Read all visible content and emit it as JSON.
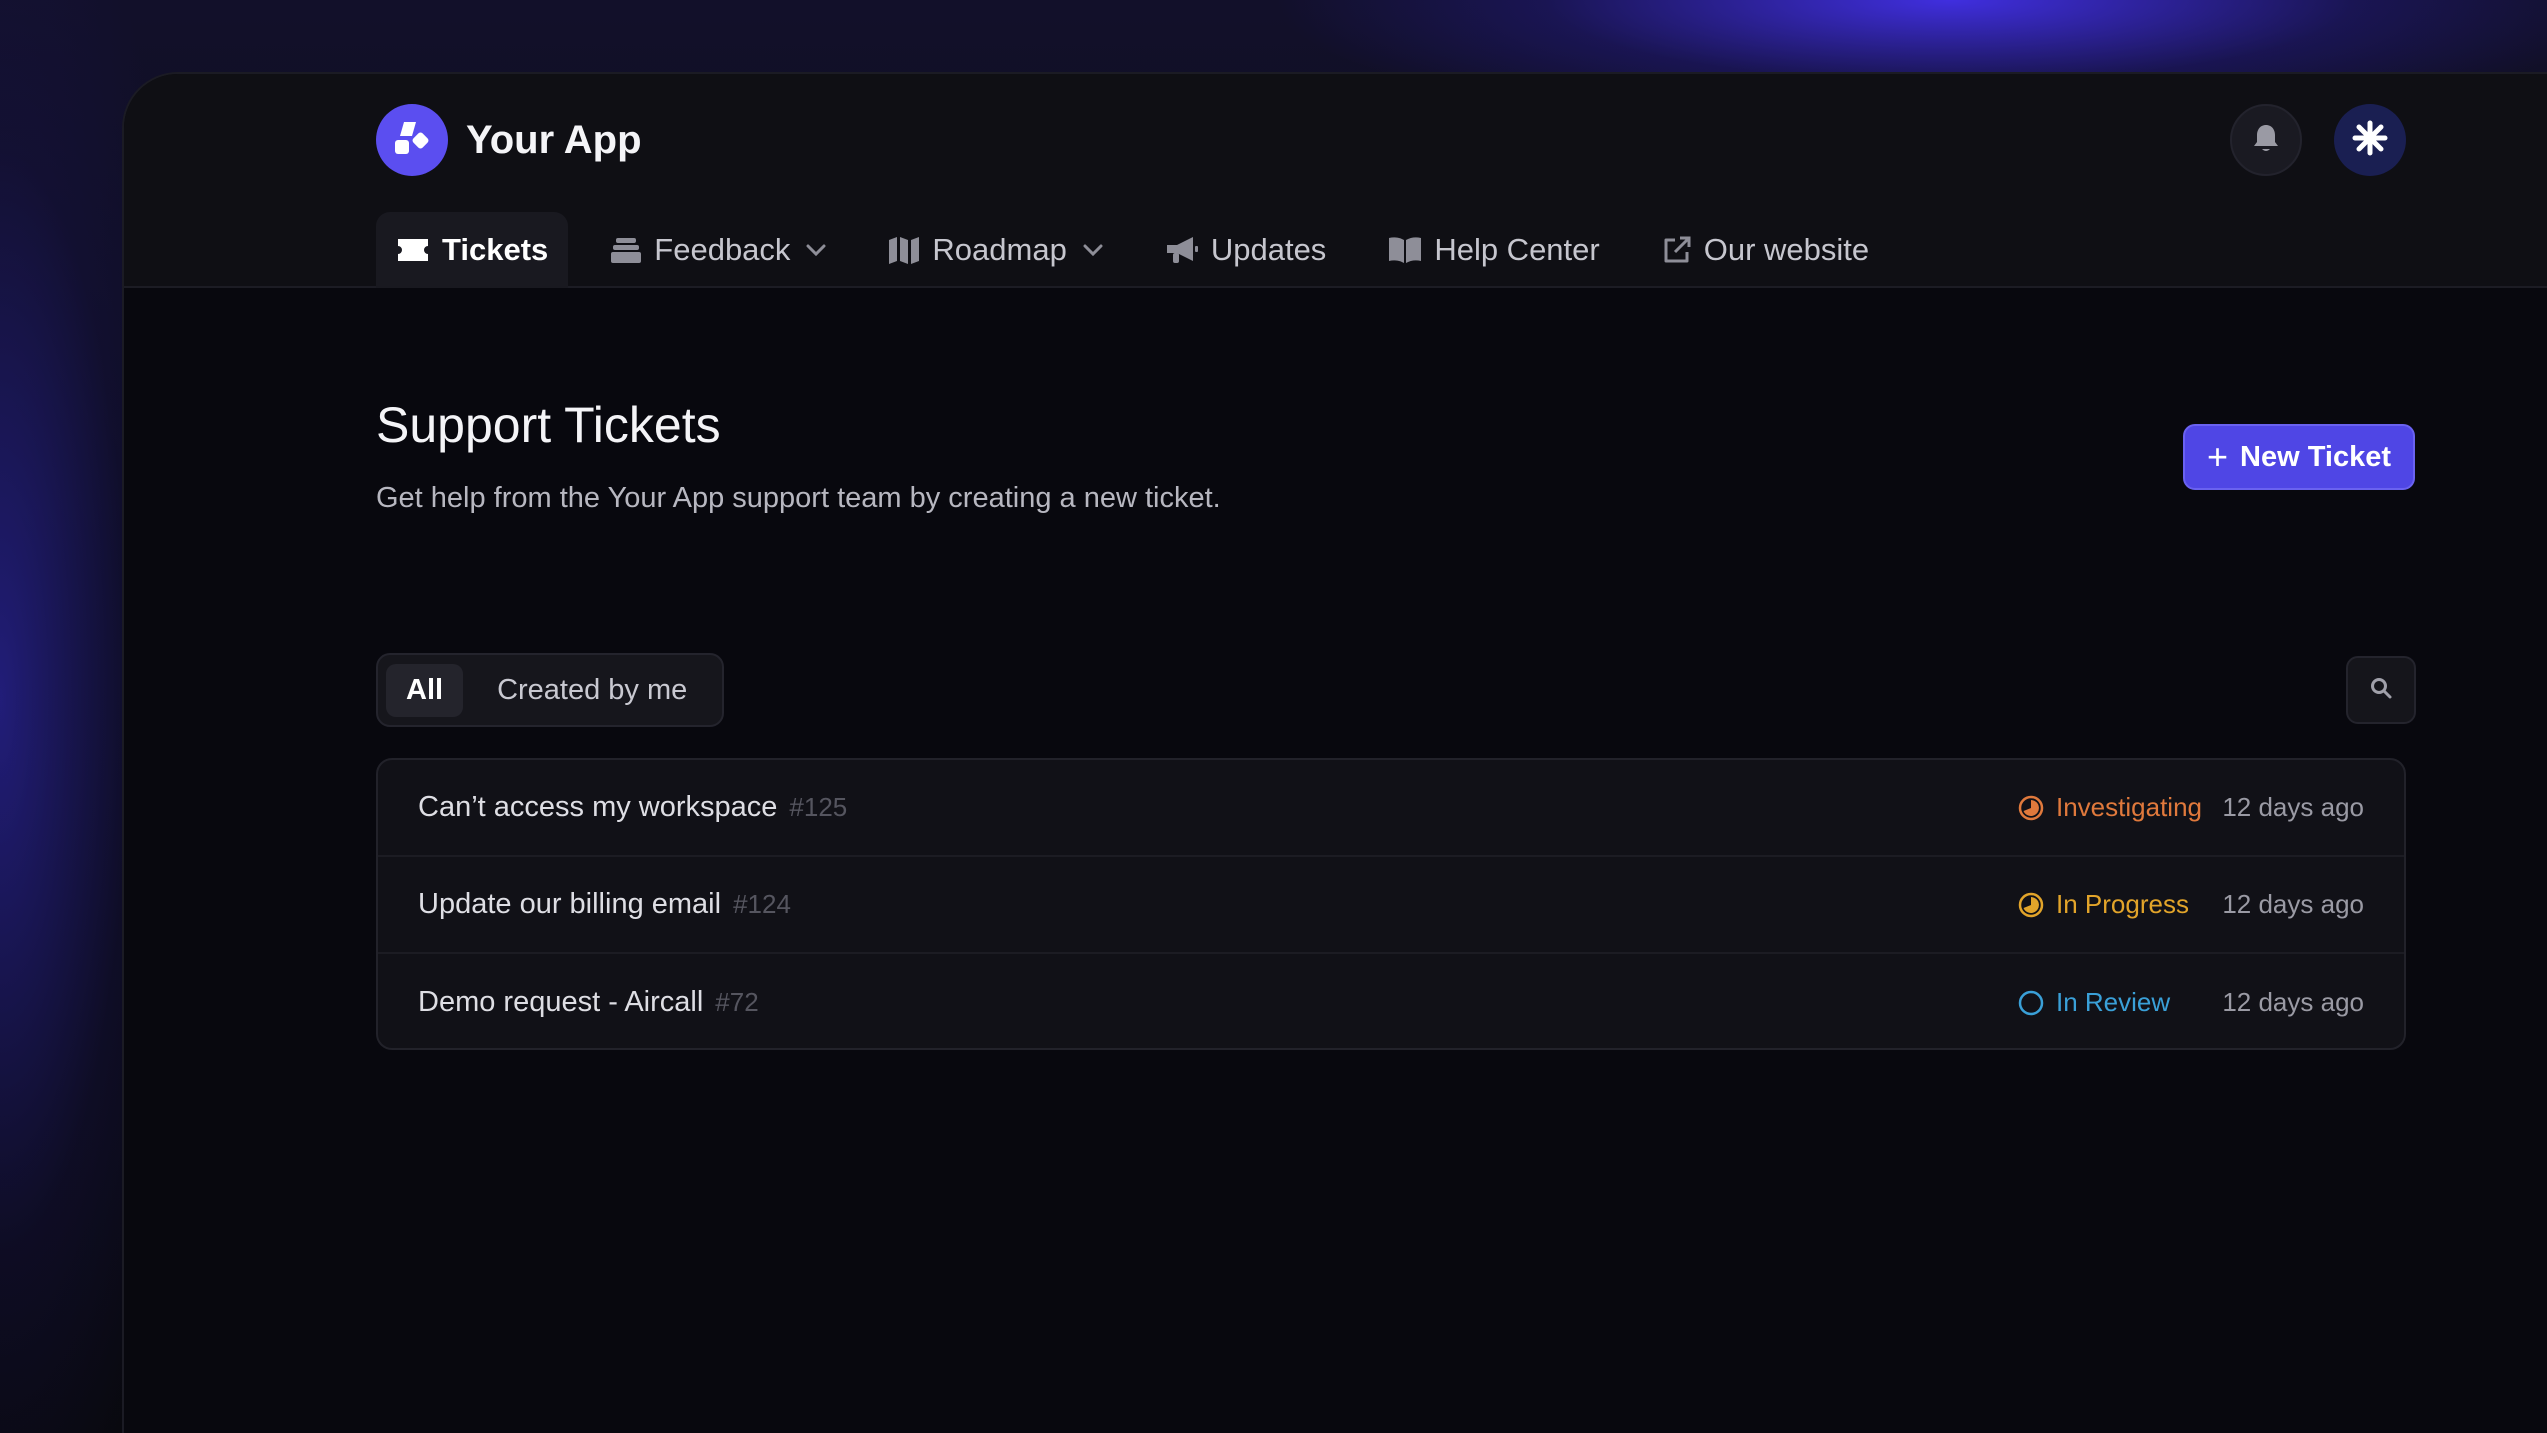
{
  "app": {
    "name": "Your App"
  },
  "nav": {
    "tabs": [
      {
        "label": "Tickets",
        "icon": "ticket-icon",
        "active": true,
        "dropdown": false
      },
      {
        "label": "Feedback",
        "icon": "inbox-icon",
        "active": false,
        "dropdown": true
      },
      {
        "label": "Roadmap",
        "icon": "map-icon",
        "active": false,
        "dropdown": true
      },
      {
        "label": "Updates",
        "icon": "megaphone-icon",
        "active": false,
        "dropdown": false
      },
      {
        "label": "Help Center",
        "icon": "book-icon",
        "active": false,
        "dropdown": false
      },
      {
        "label": "Our website",
        "icon": "external-link-icon",
        "active": false,
        "dropdown": false
      }
    ]
  },
  "header": {
    "actions": [
      "bell-icon",
      "asterisk-icon"
    ]
  },
  "page": {
    "title": "Support Tickets",
    "subtitle": "Get help from the Your App support team by creating a new ticket.",
    "new_button_label": "New Ticket"
  },
  "filters": {
    "options": [
      "All",
      "Created by me"
    ],
    "selected": "All"
  },
  "tickets": [
    {
      "title": "Can’t access my workspace",
      "number": "#125",
      "status": "Investigating",
      "status_color": "#e0793c",
      "age": "12 days ago"
    },
    {
      "title": "Update our billing email",
      "number": "#124",
      "status": "In Progress",
      "status_color": "#e2a42a",
      "age": "12 days ago"
    },
    {
      "title": "Demo request - Aircall",
      "number": "#72",
      "status": "In Review",
      "status_color": "#3aa0d8",
      "age": "12 days ago"
    }
  ],
  "colors": {
    "accent": "#4f46e5",
    "background": "#08080e"
  }
}
